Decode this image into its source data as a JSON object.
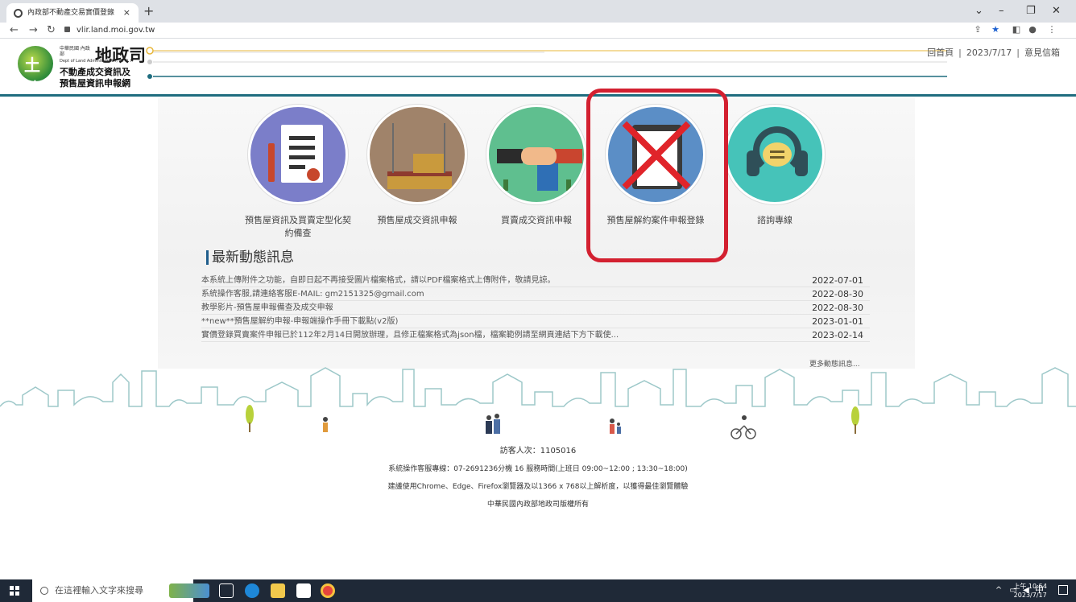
{
  "browser": {
    "tab_title": "內政部不動產交易實價登錄",
    "new_tab": "+",
    "url": "vlir.land.moi.gov.tw"
  },
  "header": {
    "logo_small": "中華民國 內政部",
    "logo_big": "地政司",
    "logo_en": "Dept of Land Administration, M. O. I.",
    "logo_line1": "不動產成交資訊及",
    "logo_line2": "預售屋資訊申報網",
    "links": {
      "home": "回首頁",
      "date": "2023/7/17",
      "feedback": "意見信箱",
      "sep": "|"
    }
  },
  "services": [
    {
      "label": "預售屋資訊及買賣定型化契約備查",
      "icon": "contract-document-icon",
      "color": "#7b7ec9"
    },
    {
      "label": "預售屋成交資訊申報",
      "icon": "construction-building-icon",
      "color": "#a0836a"
    },
    {
      "label": "買賣成交資訊申報",
      "icon": "handshake-icon",
      "color": "#5fbf8f"
    },
    {
      "label": "預售屋解約案件申報登錄",
      "icon": "clipboard-crossed-icon",
      "color": "#5b8ec6"
    },
    {
      "label": "諮詢專線",
      "icon": "headset-icon",
      "color": "#46c3b9"
    }
  ],
  "news": {
    "title": "最新動態訊息",
    "items": [
      {
        "text": "本系統上傳附件之功能，自即日起不再接受圖片檔案格式，請以PDF檔案格式上傳附件，敬請見諒。",
        "date": "2022-07-01"
      },
      {
        "text": "系統操作客服,請連絡客服E-MAIL: gm2151325@gmail.com",
        "date": "2022-08-30"
      },
      {
        "text": "教學影片-預售屋申報備查及成交申報",
        "date": "2022-08-30"
      },
      {
        "text": "**new**預售屋解約申報-申報端操作手冊下載點(v2版)",
        "date": "2023-01-01"
      },
      {
        "text": "實價登錄買賣案件申報已於112年2月14日開放辦理，且修正檔案格式為json檔，檔案範例請至網頁連結下方下載使...",
        "date": "2023-02-14"
      }
    ],
    "more": "更多動態訊息..."
  },
  "footer": {
    "visitors": "訪客人次：1105016",
    "support": "系統操作客服專線：07-2691236分機 16 服務時間(上班日 09:00~12:00 ; 13:30~18:00)",
    "browser_note": "建議使用Chrome、Edge、Firefox瀏覽器及以1366 x 768以上解析度，以獲得最佳瀏覽體驗",
    "copyright": "中華民國內政部地政司版權所有"
  },
  "taskbar": {
    "search_placeholder": "在這裡輸入文字來搜尋",
    "ime": "中",
    "time": "上午 10:54",
    "date": "2023/7/17"
  },
  "colors": {
    "header_line": "#1f6d7f",
    "highlight": "#d32030"
  }
}
